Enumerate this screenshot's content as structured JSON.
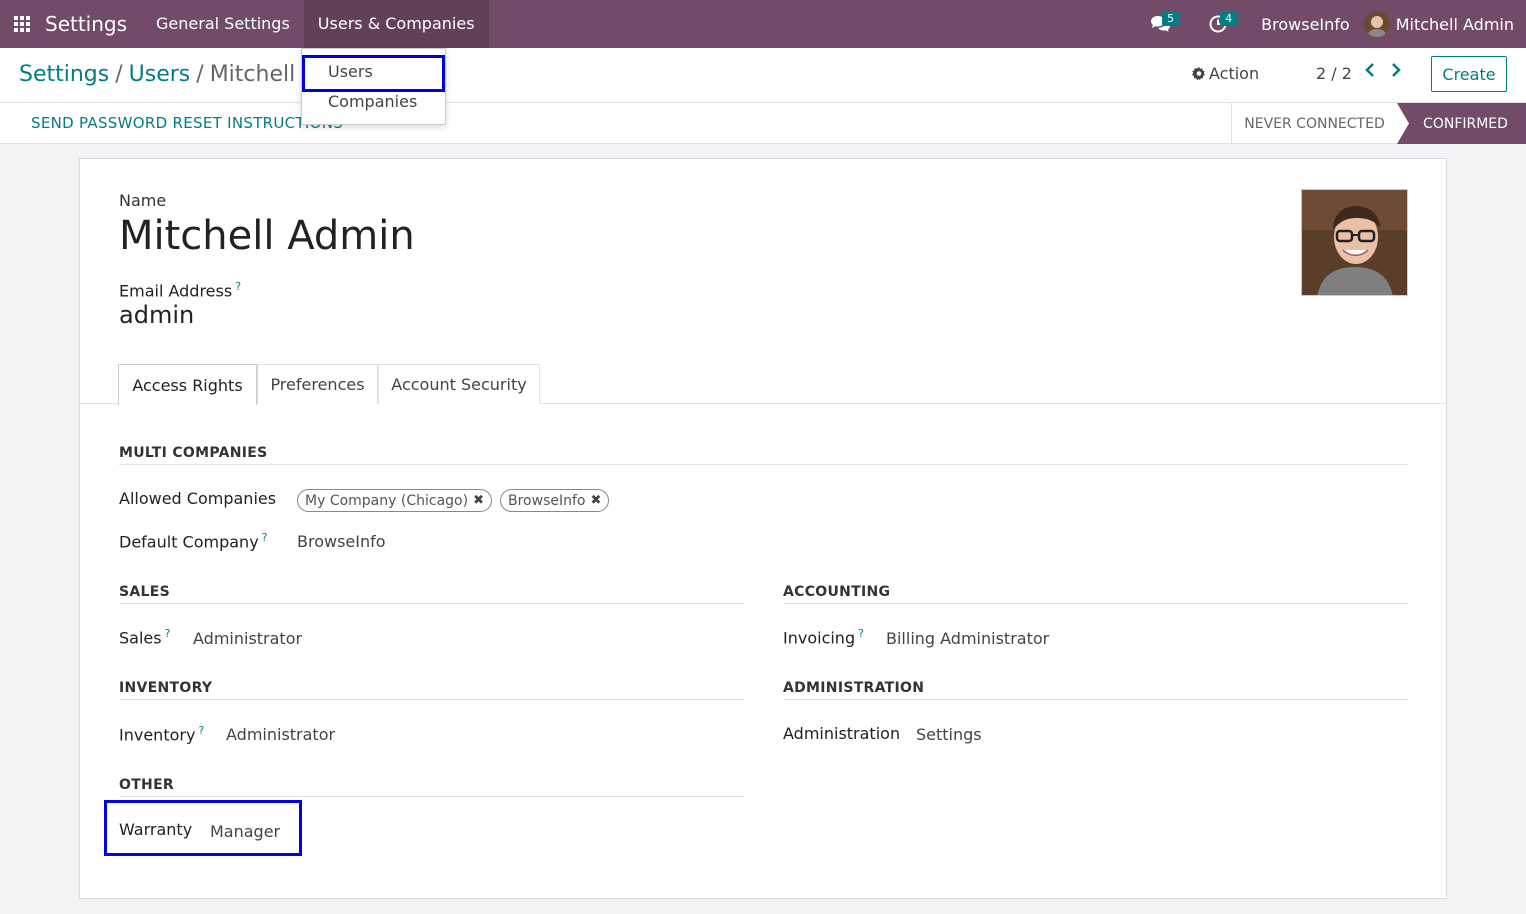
{
  "topbar": {
    "app_name": "Settings",
    "menu": [
      "General Settings",
      "Users & Companies"
    ],
    "messages_count": "5",
    "activities_count": "4",
    "company": "BrowseInfo",
    "user": "Mitchell Admin"
  },
  "dropdown": {
    "items": [
      "Users",
      "Companies"
    ]
  },
  "breadcrumb": {
    "items": [
      "Settings",
      "Users",
      "Mitchell"
    ],
    "separator": "/"
  },
  "toolbar": {
    "action_label": "Action",
    "pager": "2 / 2",
    "create_label": "Create"
  },
  "statusbar": {
    "reset_button": "SEND PASSWORD RESET INSTRUCTIONS",
    "stages": [
      "NEVER CONNECTED",
      "CONFIRMED"
    ],
    "active_stage": "CONFIRMED"
  },
  "form": {
    "name_label": "Name",
    "name_value": "Mitchell Admin",
    "email_label": "Email Address",
    "email_help": "?",
    "email_value": "admin",
    "tabs": [
      "Access Rights",
      "Preferences",
      "Account Security"
    ],
    "active_tab": "Access Rights",
    "multi_companies": {
      "title": "MULTI COMPANIES",
      "allowed_label": "Allowed Companies",
      "allowed_tags": [
        "My Company (Chicago)",
        "BrowseInfo"
      ],
      "default_label": "Default Company",
      "default_help": "?",
      "default_value": "BrowseInfo"
    },
    "sales": {
      "title": "SALES",
      "label": "Sales",
      "help": "?",
      "value": "Administrator"
    },
    "accounting": {
      "title": "ACCOUNTING",
      "label": "Invoicing",
      "help": "?",
      "value": "Billing Administrator"
    },
    "inventory": {
      "title": "INVENTORY",
      "label": "Inventory",
      "help": "?",
      "value": "Administrator"
    },
    "administration": {
      "title": "ADMINISTRATION",
      "label": "Administration",
      "value": "Settings"
    },
    "other": {
      "title": "OTHER",
      "label": "Warranty",
      "value": "Manager"
    }
  },
  "colors": {
    "brand": "#714b67",
    "accent": "#017e84",
    "highlight": "#0000e6"
  },
  "icons": [
    "apps-grid-icon",
    "chat-icon",
    "clock-icon",
    "gear-icon",
    "chevron-left-icon",
    "chevron-right-icon",
    "close-icon"
  ]
}
